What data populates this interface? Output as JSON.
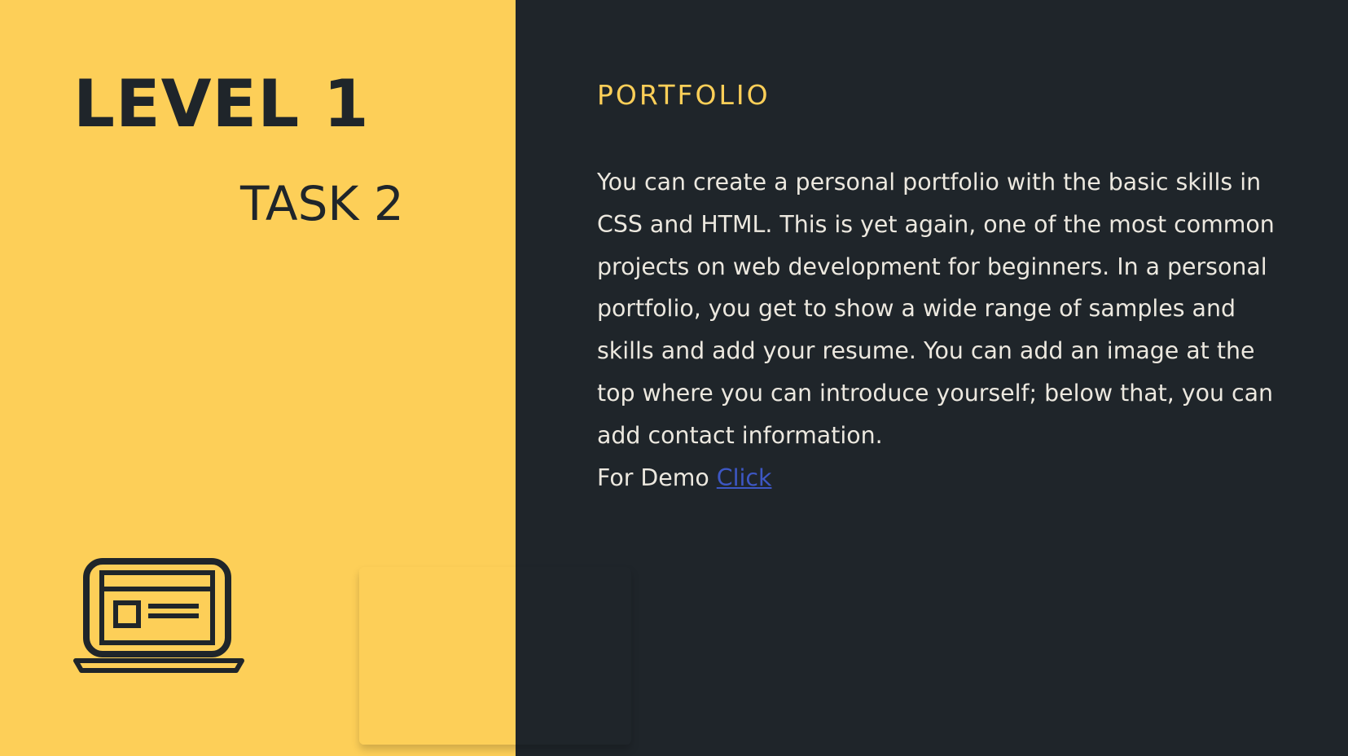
{
  "slide": {
    "level_title": "LEVEL 1",
    "task_title": "TASK 2",
    "section_heading": "PORTFOLIO",
    "description": "You can create a personal portfolio with the basic skills in CSS and HTML. This is yet again, one of the most common projects on web development for beginners. In a personal portfolio, you get to show a wide range of samples and skills and add your resume. You can add an image at the top where you can introduce yourself; below that, you can add contact information.",
    "demo_prefix": "For Demo",
    "demo_link_label": "Click"
  },
  "icons": {
    "illustration": "laptop-icon"
  },
  "colors": {
    "accent_yellow": "#fdcf58",
    "dark_background": "#1f252a",
    "body_text": "#ece8df",
    "link": "#3d57c4"
  }
}
